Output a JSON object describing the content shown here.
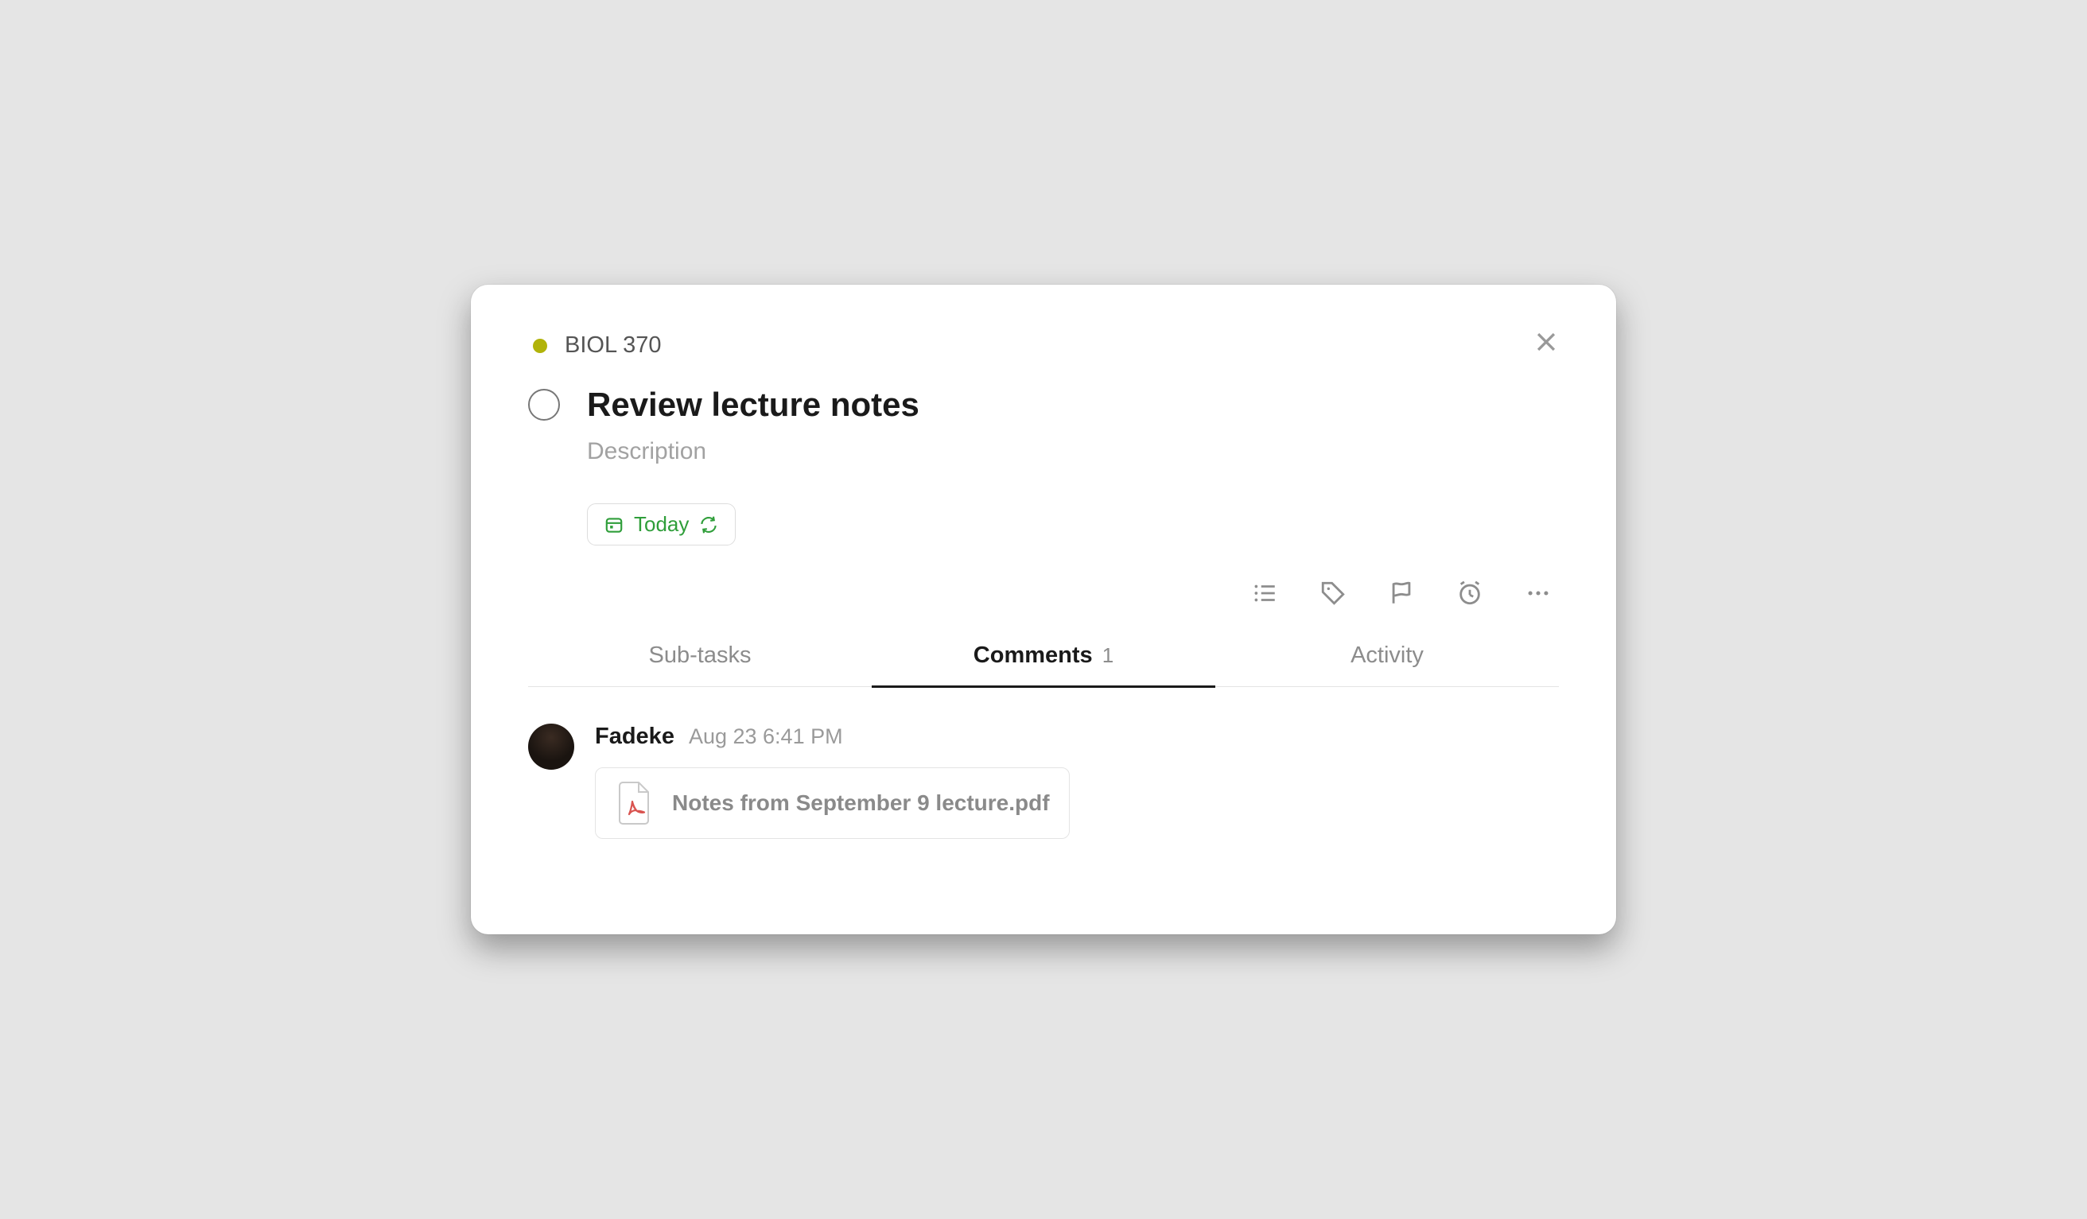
{
  "project": {
    "name": "BIOL 370",
    "color": "#b1b30a"
  },
  "task": {
    "title": "Review lecture notes",
    "description_placeholder": "Description",
    "due_label": "Today"
  },
  "tabs": {
    "subtasks": {
      "label": "Sub-tasks"
    },
    "comments": {
      "label": "Comments",
      "count": "1"
    },
    "activity": {
      "label": "Activity"
    },
    "active": "comments"
  },
  "comments": [
    {
      "author": "Fadeke",
      "timestamp": "Aug 23 6:41 PM",
      "attachment": {
        "filename": "Notes from September 9 lecture.pdf",
        "type": "pdf"
      }
    }
  ],
  "icons": {
    "close": "close-icon",
    "due": "calendar-icon",
    "recurring": "refresh-icon",
    "list": "list-icon",
    "tag": "tag-icon",
    "flag": "flag-icon",
    "alarm": "alarm-icon",
    "more": "more-icon"
  }
}
